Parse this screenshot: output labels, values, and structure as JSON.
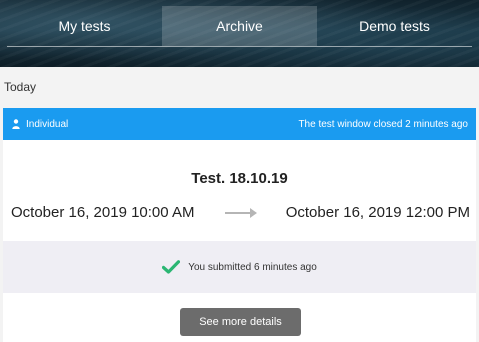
{
  "tabs": [
    {
      "label": "My tests",
      "active": false
    },
    {
      "label": "Archive",
      "active": true
    },
    {
      "label": "Demo tests",
      "active": false
    }
  ],
  "section_label": "Today",
  "card": {
    "mode_label": "Individual",
    "mode_icon": "person-icon",
    "window_status": "The test window closed 2 minutes ago",
    "bar_color": "#1a9bf0",
    "title": "Test. 18.10.19",
    "start": "October 16, 2019 10:00 AM",
    "end": "October 16, 2019 12:00 PM",
    "submission_status": "You submitted 6 minutes ago",
    "status_icon": "check-icon",
    "check_color": "#2bb673",
    "details_button": "See more details"
  }
}
